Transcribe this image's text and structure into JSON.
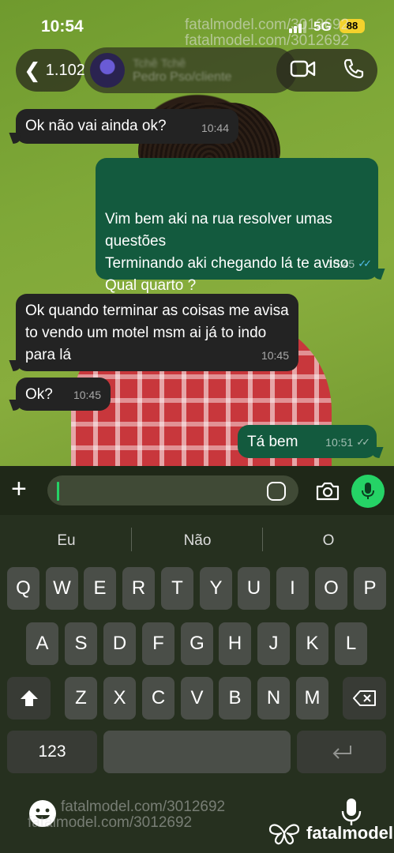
{
  "status_bar": {
    "time": "10:54",
    "network": "5G",
    "battery": "88"
  },
  "header": {
    "back_count": "1.102",
    "contact_name": "Tchê Tchê",
    "contact_subtitle": "Pedro Pso/cliente"
  },
  "watermark": {
    "line1": "fatalmodel.com/3012692",
    "line2": "fatalmodel.com/3012692"
  },
  "messages": [
    {
      "direction": "in",
      "text": "Ok não vai ainda ok?",
      "time": "10:44"
    },
    {
      "direction": "out",
      "text": "Vim bem aki na rua resolver umas questões\nTerminando aki chegando lá te aviso\nQual quarto ?",
      "time": "10:45",
      "status": "read"
    },
    {
      "direction": "in",
      "text": "Ok quando terminar as coisas me avisa to vendo um motel msm ai já to indo para lá",
      "time": "10:45"
    },
    {
      "direction": "in",
      "text": "Ok?",
      "time": "10:45"
    },
    {
      "direction": "out",
      "text": "Tá bem",
      "time": "10:51",
      "status": "delivered"
    }
  ],
  "input": {
    "value": "",
    "placeholder": ""
  },
  "keyboard": {
    "suggestions": [
      "Eu",
      "Não",
      "O"
    ],
    "row1": [
      "Q",
      "W",
      "E",
      "R",
      "T",
      "Y",
      "U",
      "I",
      "O",
      "P"
    ],
    "row2": [
      "A",
      "S",
      "D",
      "F",
      "G",
      "H",
      "J",
      "K",
      "L"
    ],
    "row3": [
      "Z",
      "X",
      "C",
      "V",
      "B",
      "N",
      "M"
    ],
    "numbers_key": "123"
  },
  "brand": {
    "name": "fatalmodel"
  },
  "colors": {
    "outgoing_bubble": "#135a3e",
    "incoming_bubble": "#232323",
    "accent_green": "#25d366",
    "read_tick": "#53bdeb",
    "battery": "#f4d22c"
  }
}
